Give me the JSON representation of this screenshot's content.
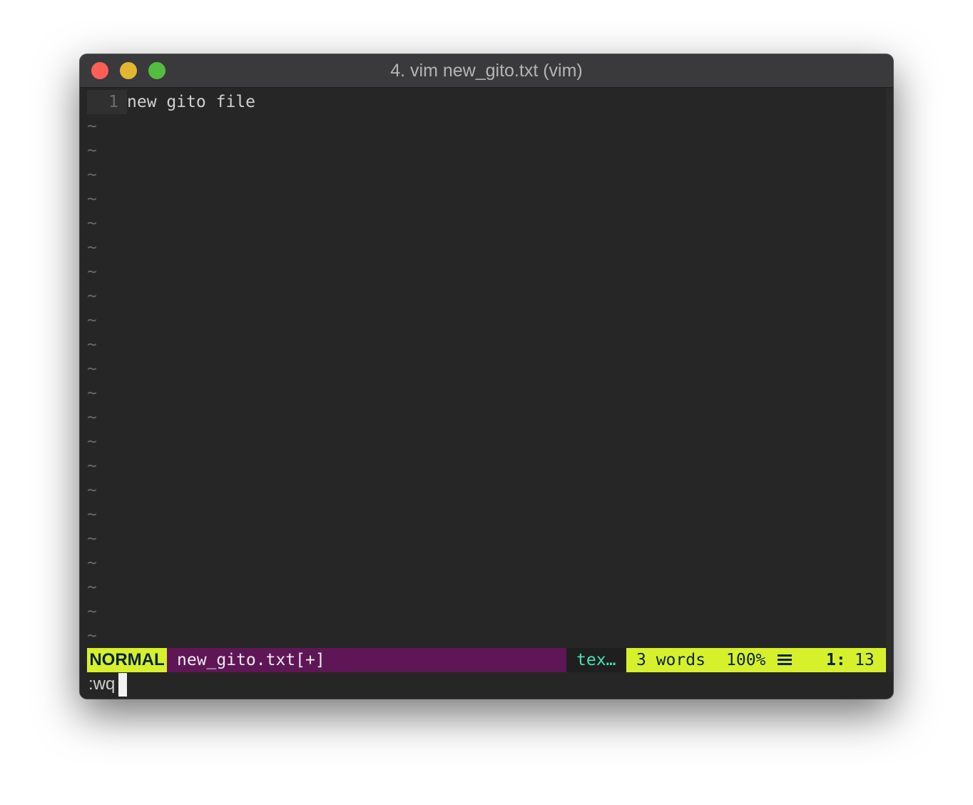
{
  "window": {
    "title": "4. vim new_gito.txt (vim)",
    "controls": [
      "close",
      "minimize",
      "maximize"
    ],
    "colors": {
      "close": "#fd5f57",
      "minimize": "#e3b631",
      "maximize": "#53be3d"
    }
  },
  "editor": {
    "lines": [
      {
        "number": "1",
        "text": "new gito file"
      }
    ],
    "tilde": "~",
    "empty_lines": 22
  },
  "statusbar": {
    "mode": "NORMAL",
    "filename": "new_gito.txt[+]",
    "filetype": "tex…",
    "words": "3 words",
    "percent": "100%",
    "menu_icon": "hamburger-icon",
    "line": "1:",
    "column": "13",
    "colors": {
      "accent": "#d7f02c",
      "filename_bg": "#5f1657",
      "filetype_fg": "#4ae0b4"
    }
  },
  "cmdline": {
    "text": ":wq"
  }
}
